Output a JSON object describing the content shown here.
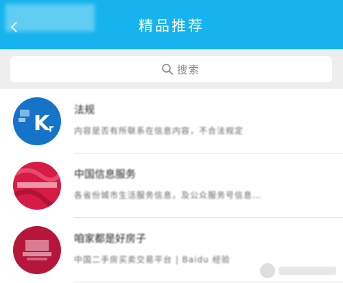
{
  "header": {
    "title": "精品推荐"
  },
  "search": {
    "placeholder": "搜索"
  },
  "list": {
    "items": [
      {
        "title": "法规",
        "description": "内容是否有所联系在信息内容，不合法规定"
      },
      {
        "title": "中国信息服务",
        "description": "各省份城市生活服务信息，及公众服务号信息…"
      },
      {
        "title": "咱家都是好房子",
        "description": "中国二手房买卖交易平台 | Baidu 经验"
      }
    ]
  },
  "colors": {
    "header_bg": "#16b3ee",
    "search_bg": "#eeeeee",
    "avatar_blue": "#1674c8",
    "avatar_red": "#d61c44",
    "avatar_crimson": "#b5163a"
  }
}
